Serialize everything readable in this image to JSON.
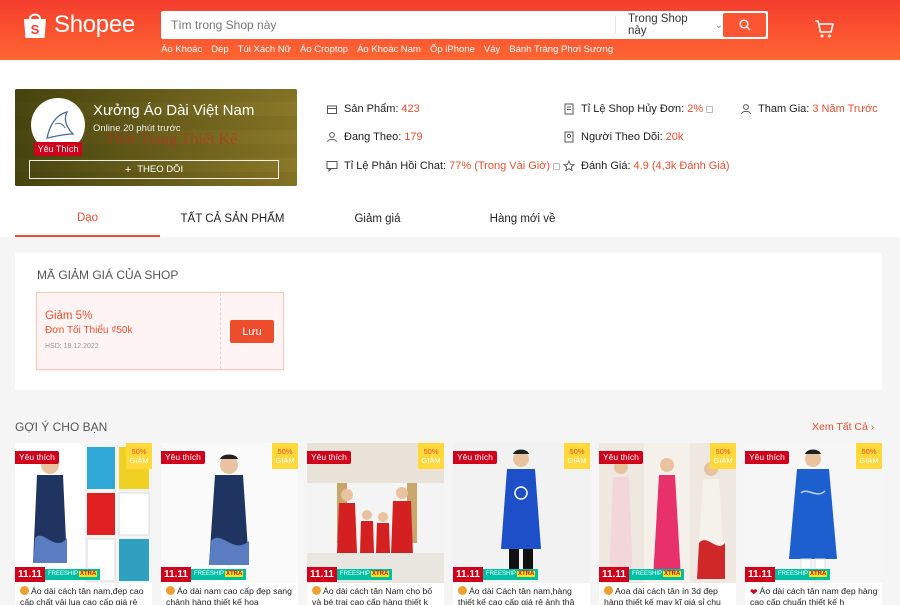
{
  "header": {
    "logo_text": "Shopee",
    "search_placeholder": "Tìm trong Shop này",
    "search_scope": "Trong Shop này",
    "suggestions": [
      "Áo Khoác",
      "Dép",
      "Túi Xách Nữ",
      "Áo Croptop",
      "Áo Khoác Nam",
      "Ốp iPhone",
      "Váy",
      "Bánh Tráng Phơi Sương"
    ],
    "colors": {
      "primary": "#ee4d2d",
      "header_start": "#f53d2d",
      "header_end": "#ff6633"
    }
  },
  "shop": {
    "name": "Xưởng Áo Dài Việt Nam",
    "online": "Online 20 phút trước",
    "badge": "Yêu Thích",
    "follow_label": "THEO DÕI",
    "banner_text": "Thời Trang Thiết Kế",
    "stats": {
      "products_label": "Sản Phẩm:",
      "products_value": "423",
      "following_label": "Đang Theo:",
      "following_value": "179",
      "chat_label": "Tỉ Lệ Phản Hồi Chat:",
      "chat_value": "77% (Trong Vài Giờ)",
      "cancel_label": "Tỉ Lệ Shop Hủy Đơn:",
      "cancel_value": "2%",
      "followers_label": "Người Theo Dõi:",
      "followers_value": "20k",
      "rating_label": "Đánh Giá:",
      "rating_value": "4.9 (4,3k Đánh Giá)",
      "joined_label": "Tham Gia:",
      "joined_value": "3 Năm Trước"
    }
  },
  "tabs": [
    "Dạo",
    "TẤT CẢ SẢN PHẨM",
    "Giảm giá",
    "Hàng mới về"
  ],
  "vouchers": {
    "title": "MÃ GIẢM GIÁ CỦA SHOP",
    "item": {
      "title": "Giảm 5%",
      "min_order": "Đơn Tối Thiểu ₫50k",
      "expiry": "HSD: 18.12.2022",
      "save_label": "Lưu"
    }
  },
  "recommendations": {
    "title": "GỢI Ý CHO BẠN",
    "see_all": "Xem Tất Cả",
    "products": [
      {
        "badge": "Yêu thích",
        "discount": "50%",
        "discount_word": "GIẢM",
        "sale_tag": "11.11",
        "free_tag": "FREESHIP",
        "free_tag_xtra": "XTRA",
        "name": "Áo dài cách tân nam,đẹp cao cấp chất vải lụa cao cấp giá rẻ"
      },
      {
        "badge": "Yêu thích",
        "discount": "50%",
        "discount_word": "GIẢM",
        "sale_tag": "11.11",
        "free_tag": "FREESHIP",
        "free_tag_xtra": "XTRA",
        "name": "Áo dài nam cao cấp đẹp sang chảnh hàng thiết kế họa"
      },
      {
        "badge": "Yêu thích",
        "discount": "50%",
        "discount_word": "GIẢM",
        "sale_tag": "11.11",
        "free_tag": "FREESHIP",
        "free_tag_xtra": "XTRA",
        "name": "Áo dài cách tân Nam cho bố và bé trai cao cấp hàng thiết k"
      },
      {
        "badge": "Yêu thích",
        "discount": "50%",
        "discount_word": "GIẢM",
        "sale_tag": "11.11",
        "free_tag": "FREESHIP",
        "free_tag_xtra": "XTRA",
        "name": "Áo dài Cách tân nam,hàng thiết kế cao cấp giá rẻ ảnh thậ"
      },
      {
        "badge": "Yêu thích",
        "discount": "50%",
        "discount_word": "GIẢM",
        "sale_tag": "11.11",
        "free_tag": "FREESHIP",
        "free_tag_xtra": "XTRA",
        "name": "Aoa dài cách tân in 3d đẹp hàng thiết kế may kĩ giá sỉ chu"
      },
      {
        "badge": "Yêu thích",
        "discount": "50%",
        "discount_word": "GIẢM",
        "sale_tag": "11.11",
        "free_tag": "FREESHIP",
        "free_tag_xtra": "XTRA",
        "name": "Áo dài cách tân nam đẹp hàng cao cấp chuẩn thiết kế h"
      }
    ]
  }
}
